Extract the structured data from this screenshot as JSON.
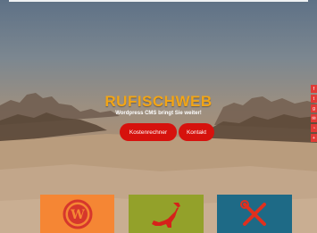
{
  "hero": {
    "brand": "RUFISCHWEB",
    "tagline": "Wordpress CMS bringt Sie weiter!",
    "buttons": {
      "calculator": "Kostenrechner",
      "contact": "Kontakt"
    }
  },
  "side_tabs": [
    "facebook-icon",
    "twitter-icon",
    "google-icon",
    "email-icon",
    "rss-icon",
    "share-icon"
  ],
  "cards": [
    {
      "icon": "wordpress-icon",
      "color": "#f58634"
    },
    {
      "icon": "dinosaur-icon",
      "color": "#93a12a"
    },
    {
      "icon": "tools-icon",
      "color": "#1e6a86"
    }
  ],
  "colors": {
    "brand": "#f2a516",
    "button": "#d6120d",
    "side_tab": "#e03a36"
  }
}
